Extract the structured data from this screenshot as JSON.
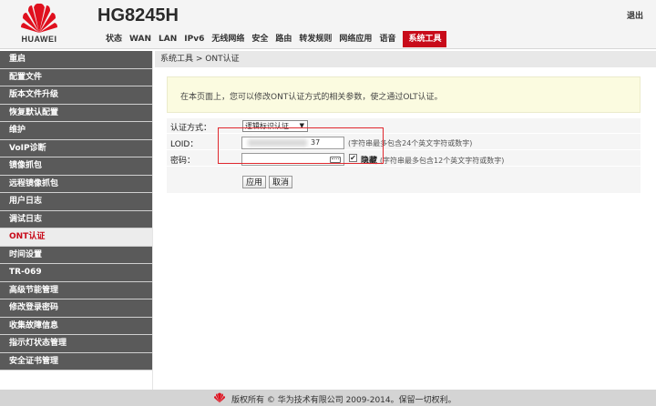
{
  "header": {
    "brand": "HUAWEI",
    "model": "HG8245H",
    "logout": "退出",
    "brand_color": "#c80b1a"
  },
  "nav": {
    "items": [
      "状态",
      "WAN",
      "LAN",
      "IPv6",
      "无线网络",
      "安全",
      "路由",
      "转发规则",
      "网络应用",
      "语音"
    ],
    "active": "系统工具"
  },
  "sidebar": {
    "items": [
      "重启",
      "配置文件",
      "版本文件升级",
      "恢复默认配置",
      "维护",
      "VoIP诊断",
      "镜像抓包",
      "远程镜像抓包",
      "用户日志",
      "调试日志",
      "ONT认证",
      "时间设置",
      "TR-069",
      "高级节能管理",
      "修改登录密码",
      "收集故障信息",
      "指示灯状态管理",
      "安全证书管理"
    ],
    "active_index": 10
  },
  "breadcrumb": "系统工具 > ONT认证",
  "notice": "在本页面上，您可以修改ONT认证方式的相关参数，使之通过OLT认证。",
  "form": {
    "auth_label": "认证方式：",
    "auth_value": "逻辑标识认证",
    "loid_label": "LOID：",
    "loid_value_suffix": "37",
    "loid_hint": "(字符串最多包含24个英文字符或数字)",
    "password_label": "密码：",
    "hide_checked": "✔",
    "hide_label": "隐藏",
    "password_hint": "(字符串最多包含12个英文字符或数字)",
    "apply_label": "应用",
    "cancel_label": "取消"
  },
  "footer": {
    "copyright": "版权所有 © 华为技术有限公司 2009-2014。保留一切权利。"
  }
}
